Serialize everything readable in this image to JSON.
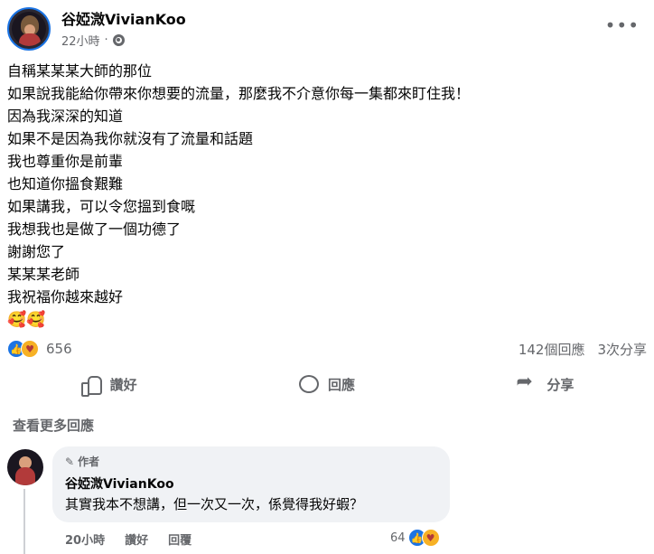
{
  "post": {
    "author": "谷婭溦VivianKoo",
    "time": "22小時",
    "lines": [
      "自稱某某某大師的那位",
      "如果說我能給你帶來你想要的流量，那麼我不介意你每一集都來盯住我！",
      "因為我深深的知道",
      "如果不是因為我你就沒有了流量和話題",
      "我也尊重你是前輩",
      "也知道你搵食艱難",
      "如果講我，可以令您搵到食嘅",
      "我想我也是做了一個功德了",
      "謝謝您了",
      "某某某老師",
      "我祝福你越來越好"
    ],
    "emoji": "🥰🥰",
    "reaction_count": "656",
    "comments_count": "142個回應",
    "shares_count": "3次分享"
  },
  "actions": {
    "like": "讚好",
    "comment": "回應",
    "share": "分享"
  },
  "more_replies": "查看更多回應",
  "comment": {
    "badge": "作者",
    "author": "谷婭溦VivianKoo",
    "text": "其實我本不想講，但一次又一次，係覺得我好蝦？",
    "time": "20小時",
    "like": "讚好",
    "reply": "回覆",
    "reaction_count": "64"
  },
  "icons": {
    "globe": "globe-icon",
    "more": "more-icon",
    "like_reaction": "like-reaction-icon",
    "care_reaction": "care-reaction-icon",
    "pen": "pen-icon"
  },
  "colors": {
    "accent": "#1b74e4",
    "secondary_text": "#65676b",
    "bubble_bg": "#f0f2f5"
  }
}
